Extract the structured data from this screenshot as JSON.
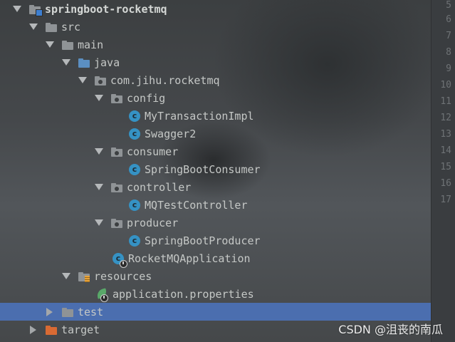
{
  "tree": {
    "project": "springboot-rocketmq",
    "src": "src",
    "main": "main",
    "java": "java",
    "package": "com.jihu.rocketmq",
    "config": "config",
    "my_transaction_impl": "MyTransactionImpl",
    "swagger2": "Swagger2",
    "consumer": "consumer",
    "spring_boot_consumer": "SpringBootConsumer",
    "controller": "controller",
    "mq_test_controller": "MQTestController",
    "producer": "producer",
    "spring_boot_producer": "SpringBootProducer",
    "rocketmq_application": "RocketMQApplication",
    "resources": "resources",
    "application_properties": "application.properties",
    "test": "test",
    "target": "target"
  },
  "class_icon_letter": "c",
  "gutter_lines": [
    "5",
    "6",
    "7",
    "8",
    "9",
    "10",
    "11",
    "12",
    "13",
    "14",
    "15",
    "16",
    "17"
  ],
  "watermark": "CSDN @沮丧的南瓜",
  "colors": {
    "selection": "#4b6eaf",
    "class_icon": "#3592c4",
    "source_folder": "#5b8fc2",
    "excluded_folder": "#d96a33",
    "spring_leaf": "#59a869"
  }
}
